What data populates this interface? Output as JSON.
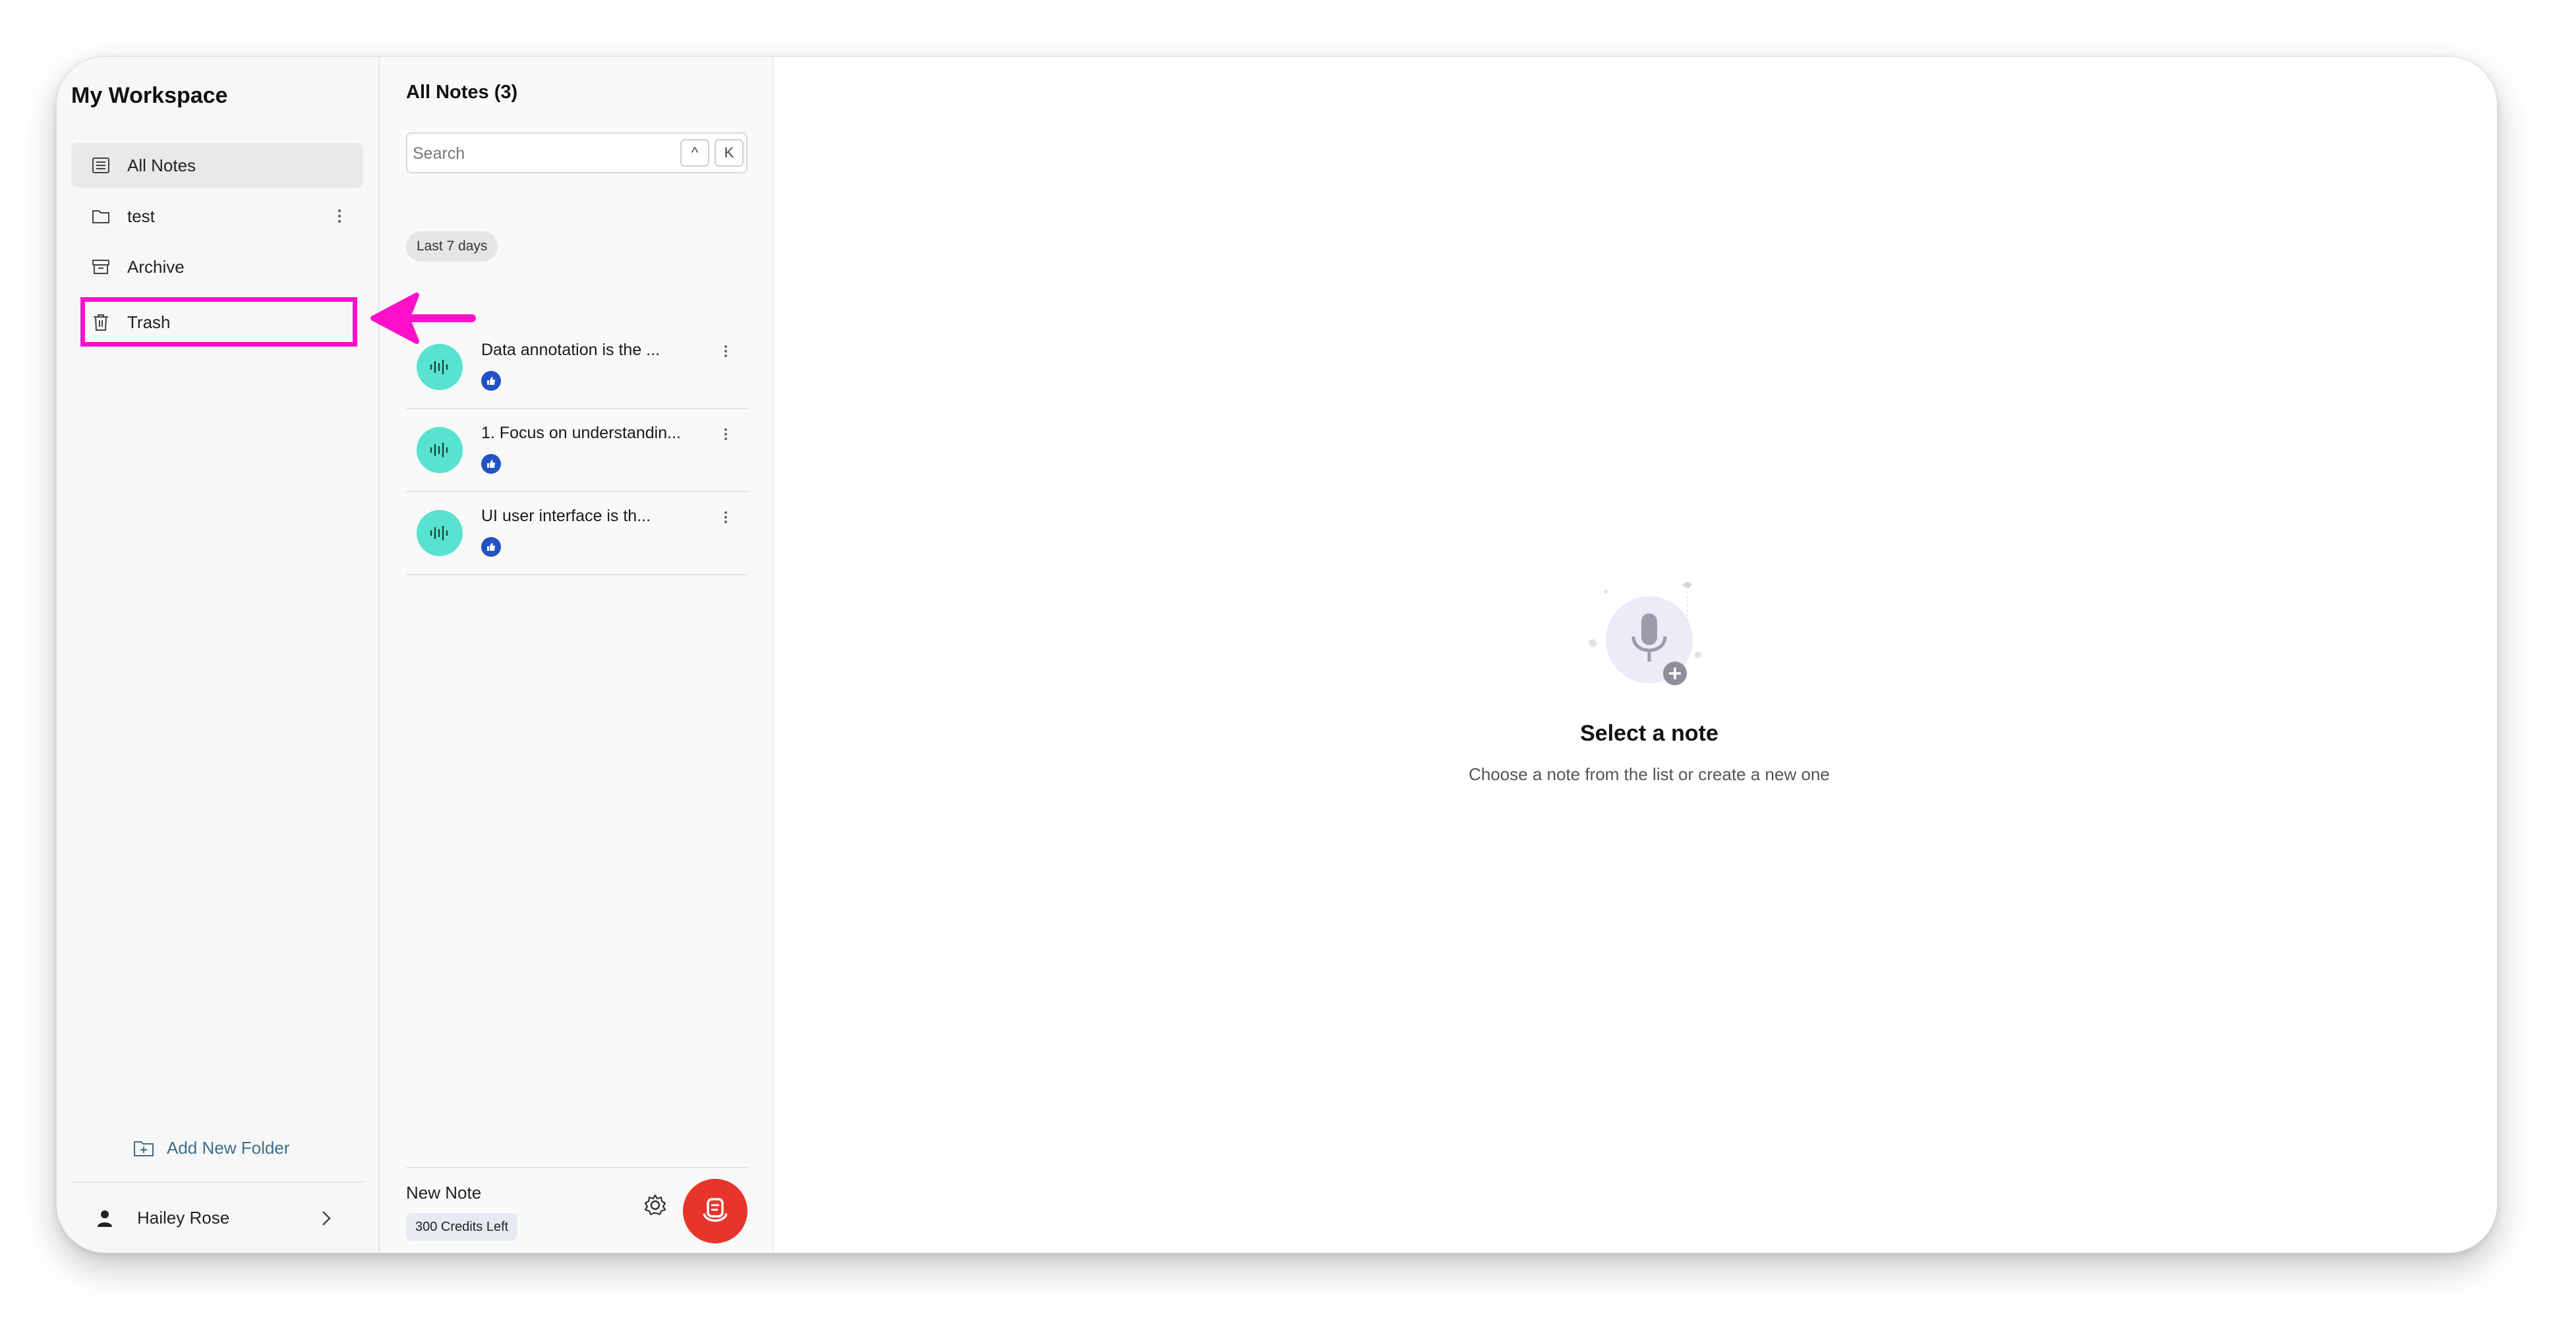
{
  "sidebar": {
    "workspace_title": "My Workspace",
    "items": [
      {
        "label": "All Notes",
        "icon": "notes-list-icon"
      },
      {
        "label": "test",
        "icon": "folder-icon"
      },
      {
        "label": "Archive",
        "icon": "archive-icon"
      },
      {
        "label": "Trash",
        "icon": "trash-icon"
      }
    ],
    "add_folder_label": "Add New Folder",
    "user_name": "Hailey Rose"
  },
  "notes_pane": {
    "title": "All Notes (3)",
    "search": {
      "placeholder": "Search",
      "value": "",
      "shortcut_keys": [
        "^",
        "K"
      ]
    },
    "group_label": "Last 7 days",
    "notes": [
      {
        "title": "Data annotation is the ..."
      },
      {
        "title": "1. Focus on understandin..."
      },
      {
        "title": "UI user interface is th..."
      }
    ],
    "footer": {
      "new_note_label": "New Note",
      "credits_label": "300 Credits Left"
    }
  },
  "main": {
    "empty_title": "Select a note",
    "empty_subtitle": "Choose a note from the list or create a new one"
  },
  "colors": {
    "highlight": "#ff10c8",
    "note_avatar": "#57e3cf",
    "note_badge": "#2352c4",
    "record_button": "#e8352b",
    "add_folder_text": "#3c6f8a"
  }
}
